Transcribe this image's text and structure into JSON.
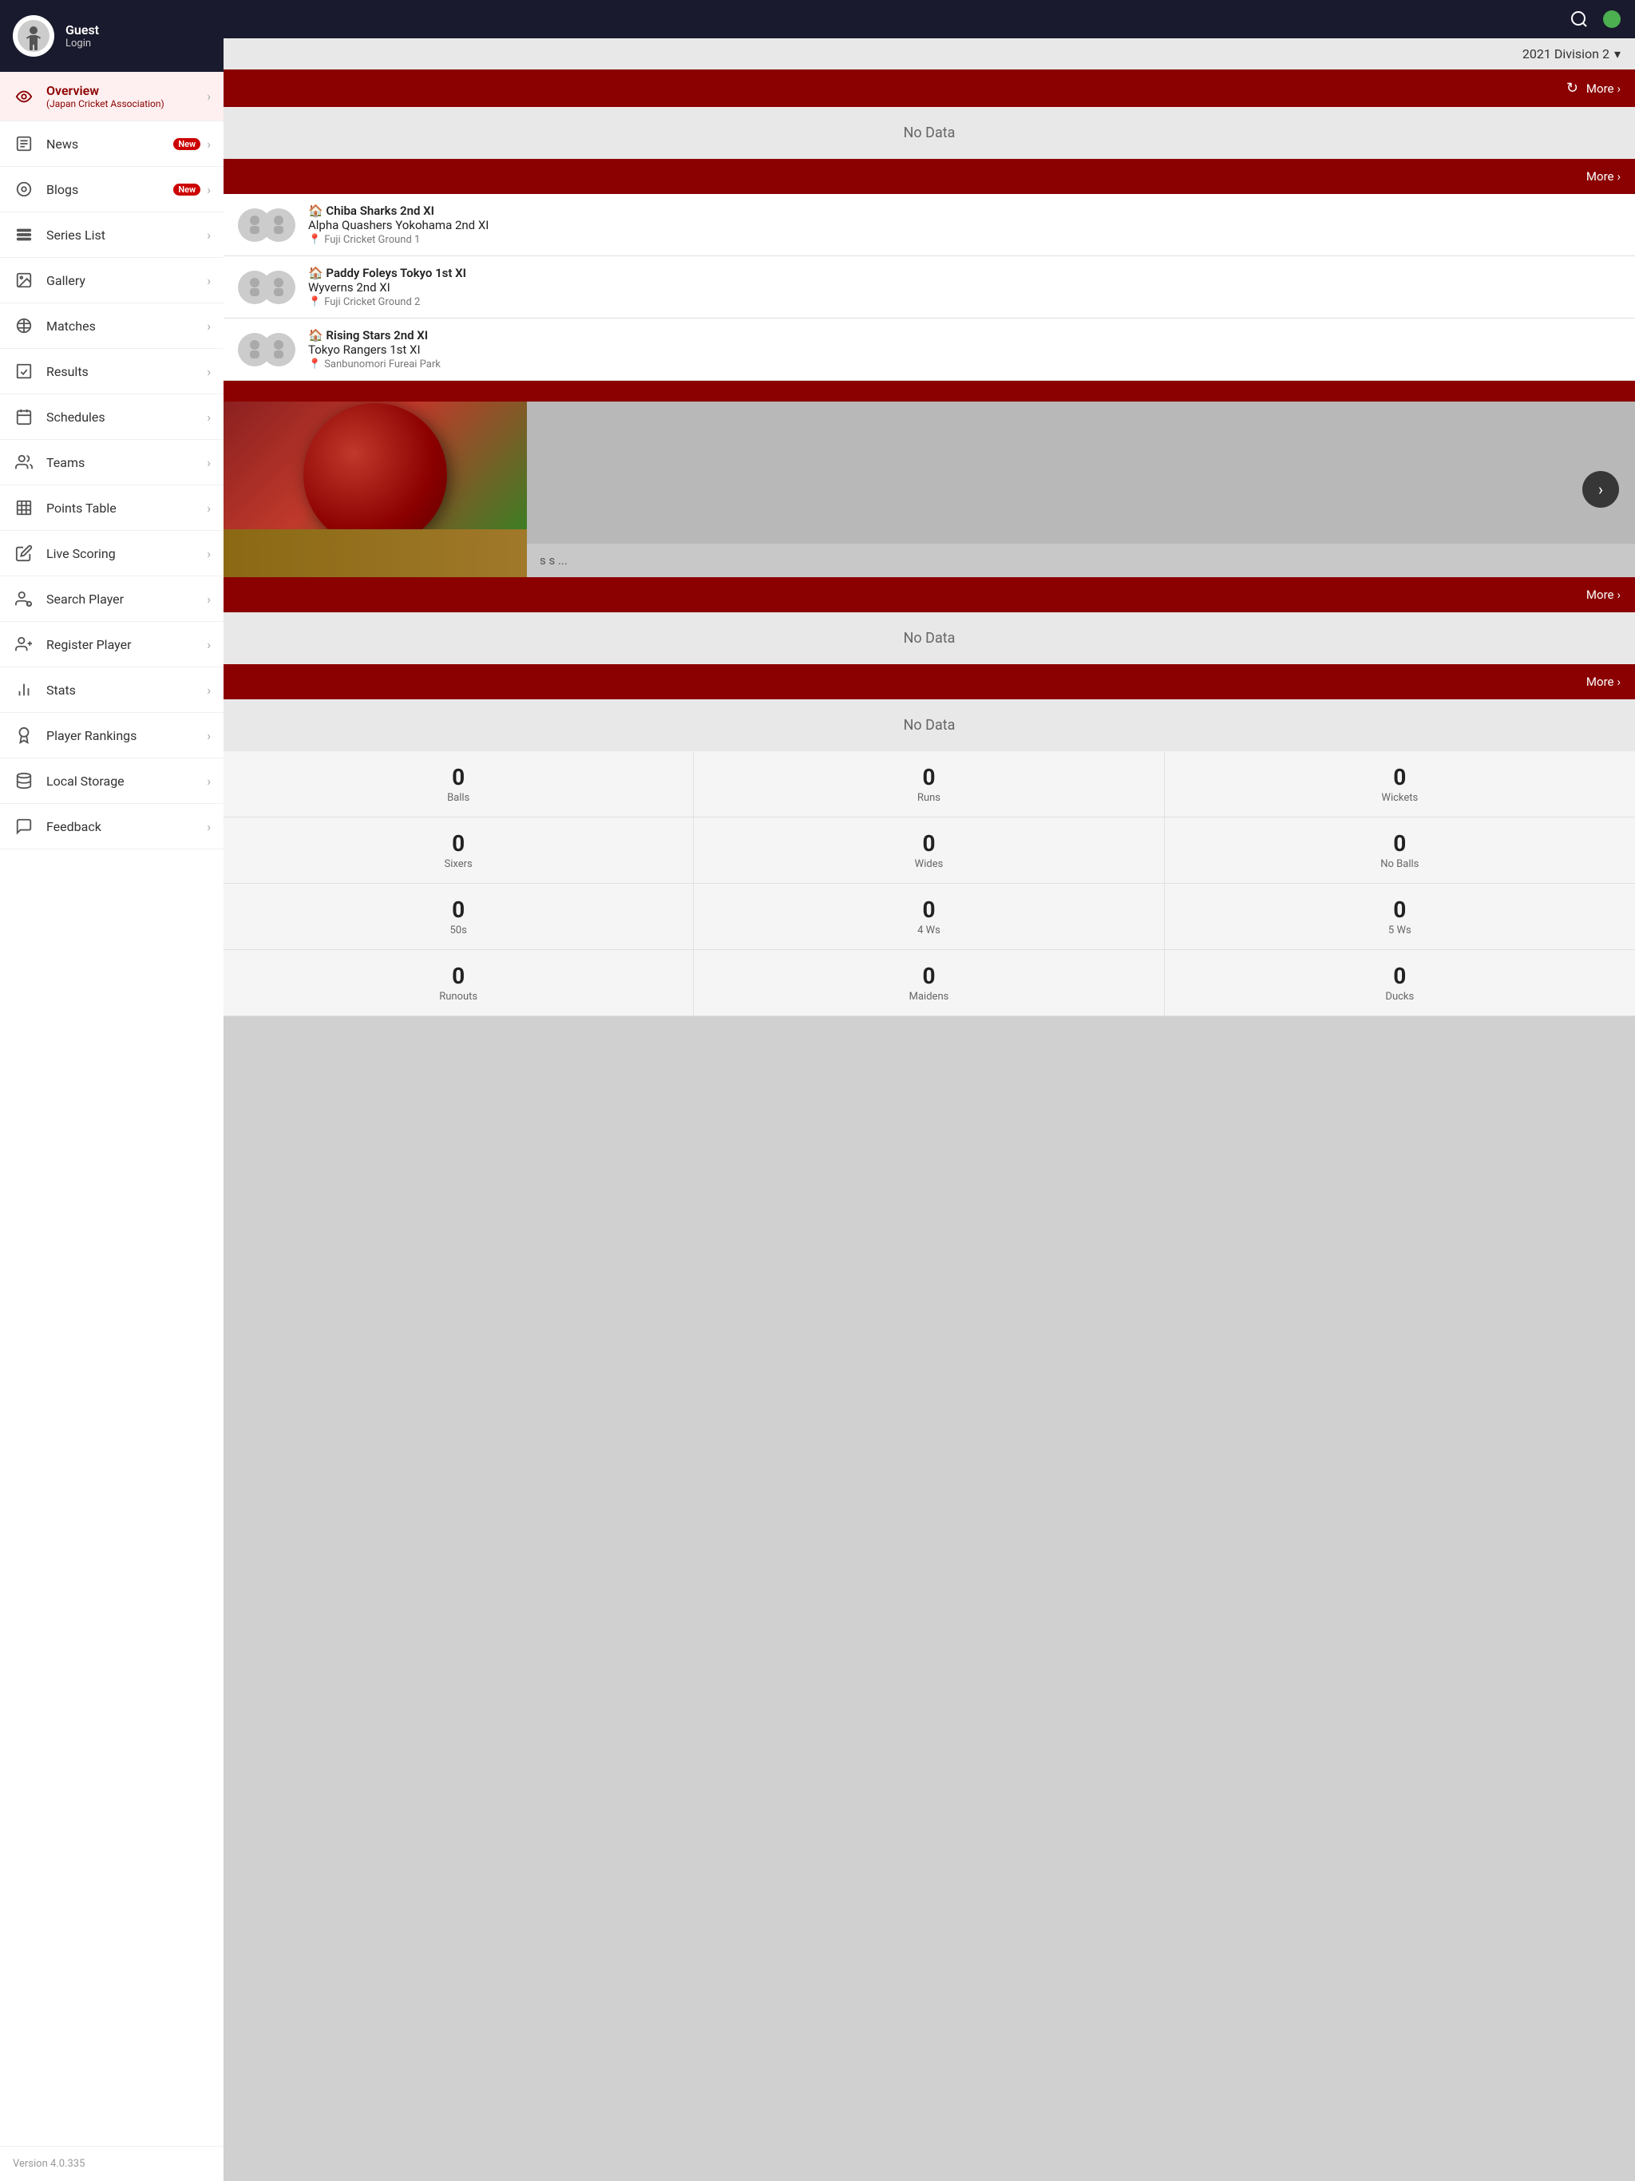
{
  "sidebar": {
    "user": {
      "name": "Guest",
      "role": "Login"
    },
    "items": [
      {
        "id": "overview",
        "label": "Overview",
        "sub": "(Japan Cricket Association)",
        "active": true,
        "badge": null,
        "icon": "eye-icon"
      },
      {
        "id": "news",
        "label": "News",
        "badge": "New",
        "active": false,
        "icon": "news-icon"
      },
      {
        "id": "blogs",
        "label": "Blogs",
        "badge": "New",
        "active": false,
        "icon": "blog-icon"
      },
      {
        "id": "series-list",
        "label": "Series List",
        "badge": null,
        "active": false,
        "icon": "list-icon"
      },
      {
        "id": "gallery",
        "label": "Gallery",
        "badge": null,
        "active": false,
        "icon": "gallery-icon"
      },
      {
        "id": "matches",
        "label": "Matches",
        "badge": null,
        "active": false,
        "icon": "matches-icon"
      },
      {
        "id": "results",
        "label": "Results",
        "badge": null,
        "active": false,
        "icon": "results-icon"
      },
      {
        "id": "schedules",
        "label": "Schedules",
        "badge": null,
        "active": false,
        "icon": "schedules-icon"
      },
      {
        "id": "teams",
        "label": "Teams",
        "badge": null,
        "active": false,
        "icon": "teams-icon"
      },
      {
        "id": "points-table",
        "label": "Points Table",
        "badge": null,
        "active": false,
        "icon": "points-icon"
      },
      {
        "id": "live-scoring",
        "label": "Live Scoring",
        "badge": null,
        "active": false,
        "icon": "live-icon"
      },
      {
        "id": "search-player",
        "label": "Search Player",
        "badge": null,
        "active": false,
        "icon": "search-player-icon"
      },
      {
        "id": "register-player",
        "label": "Register Player",
        "badge": null,
        "active": false,
        "icon": "register-icon"
      },
      {
        "id": "stats",
        "label": "Stats",
        "badge": null,
        "active": false,
        "icon": "stats-icon"
      },
      {
        "id": "player-rankings",
        "label": "Player Rankings",
        "badge": null,
        "active": false,
        "icon": "rankings-icon"
      },
      {
        "id": "local-storage",
        "label": "Local Storage",
        "badge": null,
        "active": false,
        "icon": "storage-icon"
      },
      {
        "id": "feedback",
        "label": "Feedback",
        "badge": null,
        "active": false,
        "icon": "feedback-icon"
      }
    ],
    "version": "Version 4.0.335"
  },
  "topbar": {
    "search_icon": "🔍",
    "status_dot_color": "#4caf50"
  },
  "division": {
    "label": "2021 Division 2",
    "arrow": "▾"
  },
  "sections": [
    {
      "id": "section-news",
      "more_label": "More",
      "content_type": "no-data",
      "no_data_text": "No Data",
      "show_refresh": true
    },
    {
      "id": "section-matches",
      "more_label": "More",
      "content_type": "matches",
      "matches": [
        {
          "team1": "Chiba Sharks 2nd XI",
          "team2": "Alpha Quashers Yokohama 2nd XI",
          "venue": "Fuji Cricket Ground 1"
        },
        {
          "team1": "Paddy Foleys Tokyo 1st XI",
          "team2": "Wyverns 2nd XI",
          "venue": "Fuji Cricket Ground 2"
        },
        {
          "team1": "Rising Stars 2nd XI",
          "team2": "Tokyo Rangers 1st XI",
          "venue": "Sanbunomori Fureai Park"
        }
      ]
    },
    {
      "id": "section-blogs",
      "more_label": null,
      "content_type": "gallery",
      "caption": "s s ..."
    },
    {
      "id": "section-results",
      "more_label": "More",
      "content_type": "no-data",
      "no_data_text": "No Data"
    },
    {
      "id": "section-schedules",
      "more_label": "More",
      "content_type": "no-data",
      "no_data_text": "No Data"
    },
    {
      "id": "section-stats",
      "more_label": null,
      "content_type": "stats",
      "stats": [
        {
          "label": "Balls",
          "value": "0"
        },
        {
          "label": "Runs",
          "value": "0"
        },
        {
          "label": "Wickets",
          "value": "0"
        },
        {
          "label": "Sixers",
          "value": "0"
        },
        {
          "label": "Wides",
          "value": "0"
        },
        {
          "label": "No Balls",
          "value": "0"
        },
        {
          "label": "50s",
          "value": "0"
        },
        {
          "label": "4 Ws",
          "value": "0"
        },
        {
          "label": "5 Ws",
          "value": "0"
        },
        {
          "label": "Runouts",
          "value": "0"
        },
        {
          "label": "Maidens",
          "value": "0"
        },
        {
          "label": "Ducks",
          "value": "0"
        }
      ]
    }
  ]
}
